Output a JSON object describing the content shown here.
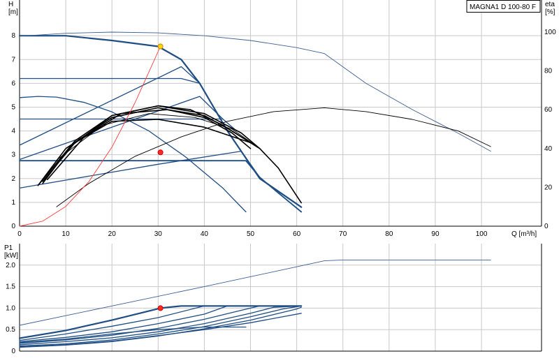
{
  "chart_data": [
    {
      "type": "line",
      "title": "MAGNA1 D 100-80 F",
      "xlabel": "Q [m³/h]",
      "ylabel": "H\n[m]",
      "y2label": "eta\n[%]",
      "xlim": [
        0,
        113
      ],
      "ylim": [
        0,
        9.5
      ],
      "y2lim": [
        0,
        116.5
      ],
      "xticks": [
        0,
        10,
        20,
        30,
        40,
        50,
        60,
        70,
        80,
        90,
        100
      ],
      "yticks": [
        0,
        1,
        2,
        3,
        4,
        5,
        6,
        7,
        8
      ],
      "y2ticks": [
        0,
        20,
        40,
        60,
        80,
        100
      ],
      "grid": true,
      "colors": {
        "pump": "#1f4e85",
        "thin": "#3f5f95",
        "eff": "#000000",
        "system": "#ff3b3b",
        "point": "#ff2a2a",
        "duty": "#ffd700"
      },
      "series": [
        {
          "role": "max-curve",
          "axis": "H",
          "points": [
            [
              0,
              8.0
            ],
            [
              10,
              8.0
            ],
            [
              20,
              7.8
            ],
            [
              30,
              7.55
            ],
            [
              35,
              7.0
            ],
            [
              39,
              6.0
            ],
            [
              45,
              4.0
            ],
            [
              52,
              2.0
            ],
            [
              61,
              0.8
            ]
          ]
        },
        {
          "role": "min-curve",
          "axis": "H",
          "points": [
            [
              0,
              2.75
            ],
            [
              20,
              2.75
            ],
            [
              35,
              2.75
            ],
            [
              49,
              2.75
            ],
            [
              52,
              2.05
            ],
            [
              56,
              1.4
            ],
            [
              61,
              0.6
            ]
          ]
        },
        {
          "role": "const-pressure",
          "axis": "H",
          "points": [
            [
              0,
              6.2
            ],
            [
              35,
              6.2
            ],
            [
              39,
              6.0
            ]
          ]
        },
        {
          "role": "const-pressure",
          "axis": "H",
          "points": [
            [
              0,
              4.5
            ],
            [
              35,
              4.5
            ],
            [
              44,
              4.5
            ],
            [
              47,
              4.0
            ]
          ]
        },
        {
          "role": "prop-pressure",
          "axis": "H",
          "points": [
            [
              0,
              3.4
            ],
            [
              35,
              6.7
            ],
            [
              39,
              6.0
            ]
          ]
        },
        {
          "role": "prop-pressure",
          "axis": "H",
          "points": [
            [
              0,
              2.8
            ],
            [
              39,
              5.45
            ],
            [
              44,
              4.5
            ]
          ]
        },
        {
          "role": "prop-pressure",
          "axis": "H",
          "points": [
            [
              0,
              1.6
            ],
            [
              30,
              2.6
            ],
            [
              48,
              3.15
            ],
            [
              52,
              2.05
            ]
          ]
        },
        {
          "role": "auto-adapt",
          "axis": "H",
          "points": [
            [
              0,
              5.4
            ],
            [
              4,
              5.45
            ],
            [
              8,
              5.42
            ],
            [
              14,
              5.2
            ],
            [
              20,
              4.8
            ],
            [
              28,
              4.0
            ],
            [
              36,
              2.9
            ],
            [
              44,
              1.6
            ],
            [
              49,
              0.6
            ]
          ]
        },
        {
          "role": "max-curve-ext",
          "axis": "H",
          "points": [
            [
              0,
              7.98
            ],
            [
              10,
              8.1
            ],
            [
              20,
              8.15
            ],
            [
              30,
              8.12
            ],
            [
              40,
              8.0
            ],
            [
              50,
              7.8
            ],
            [
              60,
              7.5
            ],
            [
              66,
              7.25
            ],
            [
              75,
              6.0
            ],
            [
              85,
              4.9
            ],
            [
              95,
              3.9
            ],
            [
              102,
              3.15
            ]
          ]
        },
        {
          "role": "efficiency",
          "axis": "eta",
          "points": [
            [
              8,
              10
            ],
            [
              15,
              22
            ],
            [
              25,
              36
            ],
            [
              35,
              46
            ],
            [
              45,
              54
            ],
            [
              55,
              59
            ],
            [
              66,
              61
            ],
            [
              75,
              59
            ],
            [
              85,
              55
            ],
            [
              95,
              49
            ],
            [
              102,
              41
            ]
          ]
        },
        {
          "role": "efficiency",
          "axis": "eta",
          "points": [
            [
              4,
              21
            ],
            [
              10,
              40
            ],
            [
              20,
              56
            ],
            [
              30,
              61
            ],
            [
              40,
              56
            ],
            [
              46,
              48
            ],
            [
              50,
              40
            ]
          ]
        },
        {
          "role": "efficiency",
          "axis": "eta",
          "points": [
            [
              5,
              22
            ],
            [
              11,
              41
            ],
            [
              20,
              57
            ],
            [
              30,
              62
            ],
            [
              40,
              58
            ],
            [
              48,
              48
            ],
            [
              52,
              40
            ]
          ]
        },
        {
          "role": "efficiency",
          "axis": "eta",
          "points": [
            [
              8,
              34
            ],
            [
              18,
              52
            ],
            [
              28,
              58
            ],
            [
              38,
              56
            ],
            [
              46,
              50
            ],
            [
              52,
              40
            ]
          ]
        },
        {
          "role": "efficiency",
          "axis": "eta",
          "points": [
            [
              5,
              23
            ],
            [
              12,
              43
            ],
            [
              20,
              54
            ],
            [
              30,
              55
            ],
            [
              40,
              51
            ],
            [
              50,
              43
            ]
          ]
        },
        {
          "role": "efficiency",
          "axis": "eta",
          "points": [
            [
              6,
              24
            ],
            [
              14,
              46
            ],
            [
              22,
              58
            ],
            [
              32,
              60
            ],
            [
              40,
              57
            ],
            [
              46,
              49
            ],
            [
              52,
              40
            ]
          ]
        },
        {
          "role": "efficiency",
          "axis": "eta",
          "points": [
            [
              4,
              21
            ],
            [
              12,
              44
            ],
            [
              20,
              57
            ],
            [
              30,
              62
            ],
            [
              37,
              60
            ],
            [
              44,
              52
            ],
            [
              52,
              40
            ],
            [
              56,
              30
            ],
            [
              61,
              12
            ]
          ]
        },
        {
          "role": "system-curve",
          "axis": "H",
          "points": [
            [
              0,
              0
            ],
            [
              5,
              0.21
            ],
            [
              10,
              0.83
            ],
            [
              15,
              1.87
            ],
            [
              20,
              3.32
            ],
            [
              25,
              5.19
            ],
            [
              30.5,
              7.55
            ]
          ]
        }
      ],
      "markers": [
        {
          "role": "duty-point",
          "axis": "H",
          "x": 30.5,
          "y": 7.55
        },
        {
          "role": "eff-point",
          "axis": "H",
          "x": 30.5,
          "y": 3.1
        }
      ]
    },
    {
      "type": "line",
      "xlabel": "",
      "ylabel": "P1\n[kW]",
      "xlim": [
        0,
        113
      ],
      "ylim": [
        0,
        2.5
      ],
      "yticks": [
        0,
        0.5,
        1.0,
        1.5,
        2.0
      ],
      "ytick_labels": [
        "0",
        "0.5",
        "1.0",
        "1.5",
        "2.0"
      ],
      "grid": true,
      "series": [
        {
          "role": "max-curve-ext",
          "points": [
            [
              0,
              0.6
            ],
            [
              20,
              1.05
            ],
            [
              40,
              1.5
            ],
            [
              66,
              2.1
            ],
            [
              70,
              2.12
            ],
            [
              102,
              2.12
            ]
          ]
        },
        {
          "role": "max-curve",
          "points": [
            [
              0,
              0.3
            ],
            [
              10,
              0.48
            ],
            [
              20,
              0.72
            ],
            [
              30.5,
              1.0
            ],
            [
              35,
              1.05
            ],
            [
              61,
              1.05
            ]
          ]
        },
        {
          "role": "power",
          "points": [
            [
              0,
              0.25
            ],
            [
              10,
              0.4
            ],
            [
              20,
              0.58
            ],
            [
              30,
              0.78
            ],
            [
              40,
              1.05
            ],
            [
              61,
              1.05
            ]
          ]
        },
        {
          "role": "power",
          "points": [
            [
              0,
              0.22
            ],
            [
              10,
              0.32
            ],
            [
              20,
              0.45
            ],
            [
              30,
              0.64
            ],
            [
              40,
              0.86
            ],
            [
              45,
              1.05
            ],
            [
              61,
              1.05
            ]
          ]
        },
        {
          "role": "power",
          "points": [
            [
              0,
              0.18
            ],
            [
              10,
              0.26
            ],
            [
              20,
              0.37
            ],
            [
              30,
              0.53
            ],
            [
              40,
              0.74
            ],
            [
              48,
              0.95
            ],
            [
              52,
              1.05
            ],
            [
              61,
              1.05
            ]
          ]
        },
        {
          "role": "power",
          "points": [
            [
              0,
              0.15
            ],
            [
              10,
              0.22
            ],
            [
              20,
              0.31
            ],
            [
              30,
              0.45
            ],
            [
              40,
              0.64
            ],
            [
              50,
              0.88
            ],
            [
              55,
              1.02
            ],
            [
              61,
              1.05
            ]
          ]
        },
        {
          "role": "power",
          "points": [
            [
              0,
              0.12
            ],
            [
              10,
              0.17
            ],
            [
              20,
              0.26
            ],
            [
              30,
              0.4
            ],
            [
              40,
              0.57
            ],
            [
              50,
              0.8
            ],
            [
              57,
              0.98
            ],
            [
              61,
              1.05
            ]
          ]
        },
        {
          "role": "power",
          "points": [
            [
              0,
              0.09
            ],
            [
              10,
              0.14
            ],
            [
              20,
              0.22
            ],
            [
              30,
              0.35
            ],
            [
              40,
              0.52
            ],
            [
              50,
              0.72
            ],
            [
              60,
              0.98
            ],
            [
              61,
              1.02
            ]
          ]
        },
        {
          "role": "min-curve",
          "points": [
            [
              0,
              0.2
            ],
            [
              10,
              0.28
            ],
            [
              20,
              0.4
            ],
            [
              30,
              0.5
            ],
            [
              40,
              0.56
            ],
            [
              49,
              0.56
            ]
          ]
        },
        {
          "role": "auto-adapt",
          "points": [
            [
              0,
              0.1
            ],
            [
              10,
              0.15
            ],
            [
              20,
              0.23
            ],
            [
              30,
              0.36
            ],
            [
              40,
              0.5
            ],
            [
              50,
              0.66
            ],
            [
              61,
              0.88
            ]
          ]
        }
      ],
      "markers": [
        {
          "role": "duty-point",
          "x": 30.5,
          "y": 1.0
        }
      ]
    }
  ]
}
